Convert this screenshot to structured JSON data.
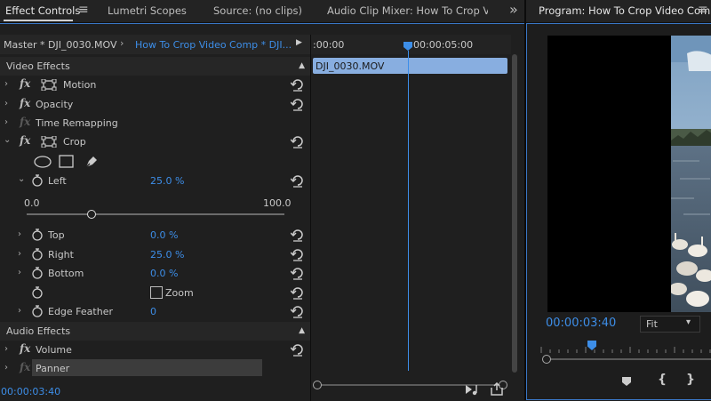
{
  "tabs": {
    "effect_controls": "Effect Controls",
    "menu_glyph": "≡",
    "lumetri": "Lumetri Scopes",
    "source": "Source: (no clips)",
    "audio_mixer": "Audio Clip Mixer: How To Crop Vide",
    "overflow": "»",
    "program": "Program: How To Crop Video Comp",
    "program_menu": "≡"
  },
  "effect_controls": {
    "master_label": "Master * DJI_0030.MOV",
    "sequence_label": "How To Crop Video Comp * DJI...",
    "play_glyph": "▶",
    "video_effects": "Video Effects",
    "effects": {
      "motion": "Motion",
      "opacity": "Opacity",
      "time_remapping": "Time Remapping",
      "crop": "Crop"
    },
    "fx_glyph": "fx",
    "left": {
      "label": "Left",
      "value": "25.0 %",
      "slider_min": "0.0",
      "slider_max": "100.0",
      "slider_fraction": 0.25
    },
    "top": {
      "label": "Top",
      "value": "0.0 %"
    },
    "right": {
      "label": "Right",
      "value": "25.0 %"
    },
    "bottom": {
      "label": "Bottom",
      "value": "0.0 %"
    },
    "zoom_label": "Zoom",
    "edge_feather": {
      "label": "Edge Feather",
      "value": "0"
    },
    "audio_effects": "Audio Effects",
    "volume": "Volume",
    "panner": "Panner",
    "timecode": "00:00:03:40"
  },
  "mini_timeline": {
    "time_start": ":00:00",
    "time_mid": "00:00:05:00",
    "clip_name": "DJI_0030.MOV"
  },
  "program": {
    "timecode": "00:00:03:40",
    "fit_label": "Fit",
    "fit_arrow": "▾",
    "mark_in": "{",
    "mark_out": "}"
  },
  "colors": {
    "accent_blue": "#3d8ee8",
    "clip_blue": "#88aee0",
    "panel_bg": "#1d1d1d"
  }
}
